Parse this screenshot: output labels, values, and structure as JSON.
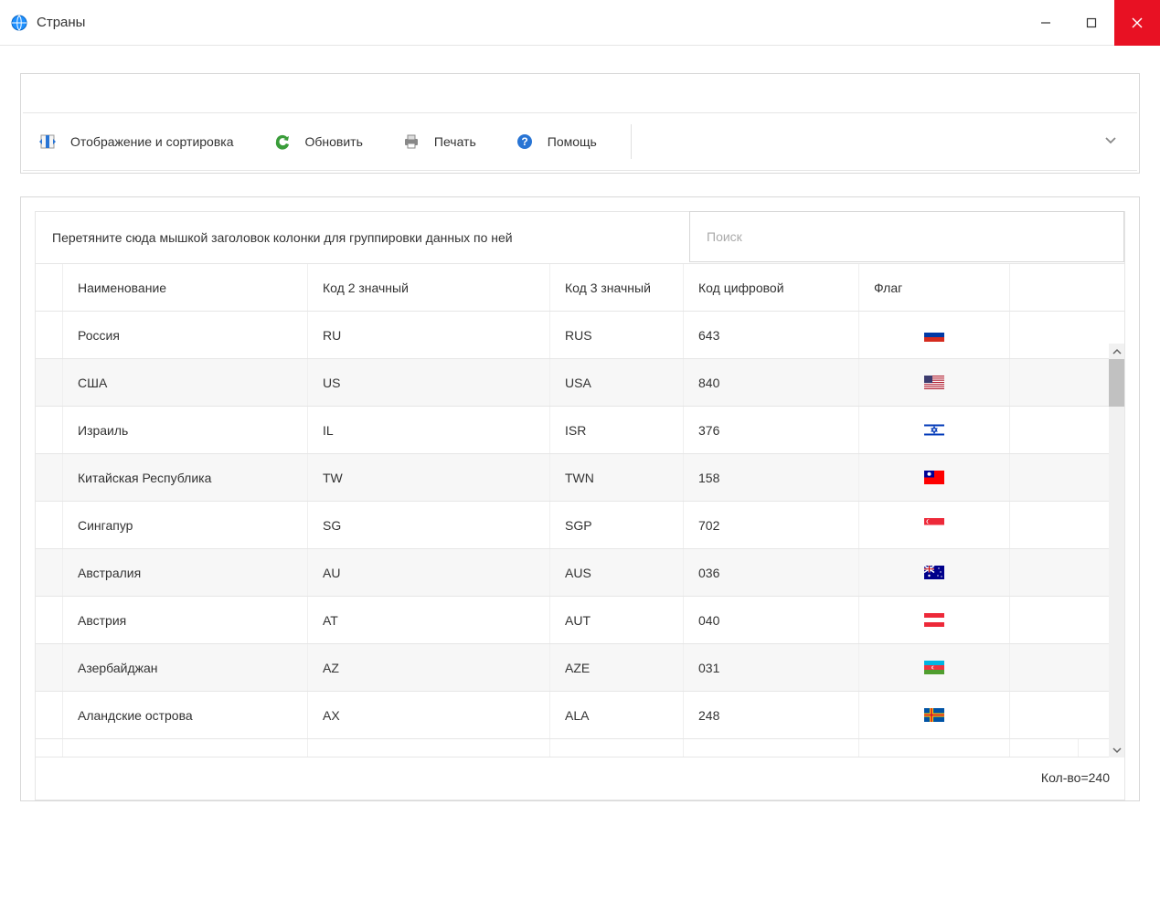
{
  "window": {
    "title": "Страны"
  },
  "toolbar": {
    "display_sort": "Отображение и сортировка",
    "refresh": "Обновить",
    "print": "Печать",
    "help": "Помощь"
  },
  "grid": {
    "group_hint": "Перетяните сюда мышкой заголовок колонки для группировки данных по ней",
    "search_placeholder": "Поиск",
    "columns": {
      "name": "Наименование",
      "code2": "Код 2 значный",
      "code3": "Код 3 значный",
      "code_num": "Код цифровой",
      "flag": "Флаг"
    },
    "rows": [
      {
        "name": "Россия",
        "code2": "RU",
        "code3": "RUS",
        "code_num": "643",
        "flag": "russia"
      },
      {
        "name": "США",
        "code2": "US",
        "code3": "USA",
        "code_num": "840",
        "flag": "usa"
      },
      {
        "name": "Израиль",
        "code2": "IL",
        "code3": "ISR",
        "code_num": "376",
        "flag": "israel"
      },
      {
        "name": "Китайская Республика",
        "code2": "TW",
        "code3": "TWN",
        "code_num": "158",
        "flag": "taiwan"
      },
      {
        "name": "Сингапур",
        "code2": "SG",
        "code3": "SGP",
        "code_num": "702",
        "flag": "singapore"
      },
      {
        "name": "Австралия",
        "code2": "AU",
        "code3": "AUS",
        "code_num": "036",
        "flag": "australia"
      },
      {
        "name": "Австрия",
        "code2": "AT",
        "code3": "AUT",
        "code_num": "040",
        "flag": "austria"
      },
      {
        "name": "Азербайджан",
        "code2": "AZ",
        "code3": "AZE",
        "code_num": "031",
        "flag": "azerbaijan"
      },
      {
        "name": "Аландские острова",
        "code2": "AX",
        "code3": "ALA",
        "code_num": "248",
        "flag": "aland"
      }
    ],
    "footer_count": "Кол-во=240"
  }
}
